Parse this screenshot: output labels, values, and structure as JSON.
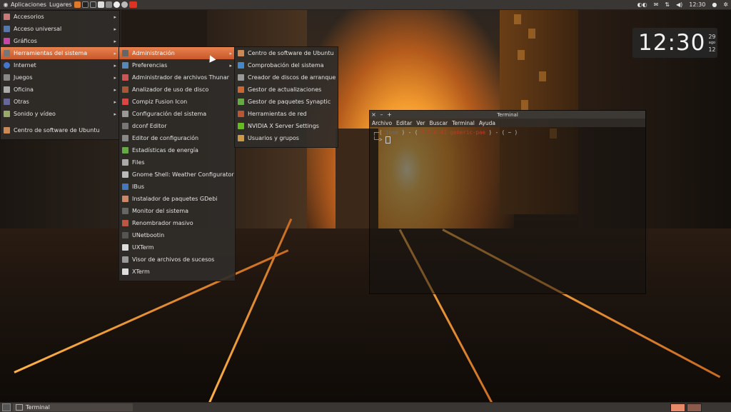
{
  "top_panel": {
    "applications": "Aplicaciones",
    "places": "Lugares",
    "launchers": [
      "firefox-icon",
      "terminal-icon",
      "terminal2-icon",
      "text-editor-icon",
      "files-icon",
      "browser-icon",
      "settings-icon",
      "youtube-icon"
    ],
    "clock": "12:30"
  },
  "apps_menu": {
    "items": [
      {
        "label": "Accesorios"
      },
      {
        "label": "Acceso universal"
      },
      {
        "label": "Gráficos"
      },
      {
        "label": "Herramientas del sistema"
      },
      {
        "label": "Internet"
      },
      {
        "label": "Juegos"
      },
      {
        "label": "Oficina"
      },
      {
        "label": "Otras"
      },
      {
        "label": "Sonido y vídeo"
      }
    ],
    "footer": "Centro de software de Ubuntu"
  },
  "system_tools_menu": {
    "items": [
      {
        "label": "Administración"
      },
      {
        "label": "Preferencias"
      },
      {
        "label": "Administrador de archivos Thunar"
      },
      {
        "label": "Analizador de uso de disco"
      },
      {
        "label": "Compiz Fusion Icon"
      },
      {
        "label": "Configuración del sistema"
      },
      {
        "label": "dconf Editor"
      },
      {
        "label": "Editor de configuración"
      },
      {
        "label": "Estadísticas de energía"
      },
      {
        "label": "Files"
      },
      {
        "label": "Gnome Shell: Weather Configurator"
      },
      {
        "label": "IBus"
      },
      {
        "label": "Instalador de paquetes GDebi"
      },
      {
        "label": "Monitor del sistema"
      },
      {
        "label": "Renombrador masivo"
      },
      {
        "label": "UNetbootin"
      },
      {
        "label": "UXTerm"
      },
      {
        "label": "Visor de archivos de sucesos"
      },
      {
        "label": "XTerm"
      }
    ]
  },
  "admin_menu": {
    "items": [
      {
        "label": "Centro de software de Ubuntu"
      },
      {
        "label": "Comprobación del sistema"
      },
      {
        "label": "Creador de discos de arranque"
      },
      {
        "label": "Gestor de actualizaciones"
      },
      {
        "label": "Gestor de paquetes Synaptic"
      },
      {
        "label": "Herramientas de red"
      },
      {
        "label": "NVIDIA X Server Settings"
      },
      {
        "label": "Usuarios y grupos"
      }
    ]
  },
  "clock_widget": {
    "time": "12:30",
    "day": "29",
    "month": "ago",
    "extra": "12"
  },
  "terminal": {
    "title": "Terminal",
    "menu": [
      "Archivo",
      "Editar",
      "Ver",
      "Buscar",
      "Terminal",
      "Ayuda"
    ],
    "prompt_line": {
      "pre": "( ",
      "user": "jose",
      "mid": " ) - ( ",
      "kernel": "3.2.0-41-generic-pae",
      "post": " ) - ( ~ )"
    },
    "prompt_symbol": ">"
  },
  "bottom_panel": {
    "task_label": "Terminal"
  },
  "colors": {
    "accent": "#d9673a",
    "panel": "#3a3633"
  }
}
